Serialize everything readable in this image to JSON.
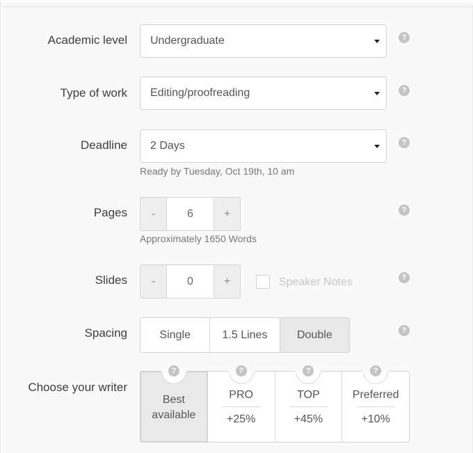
{
  "form": {
    "academic_level": {
      "label": "Academic level",
      "value": "Undergraduate"
    },
    "type_of_work": {
      "label": "Type of work",
      "value": "Editing/proofreading"
    },
    "deadline": {
      "label": "Deadline",
      "value": "2 Days",
      "hint": "Ready by Tuesday, Oct 19th, 10 am"
    },
    "pages": {
      "label": "Pages",
      "value": "6",
      "decrement": "-",
      "increment": "+",
      "hint": "Approximately 1650 Words"
    },
    "slides": {
      "label": "Slides",
      "value": "0",
      "decrement": "-",
      "increment": "+",
      "speaker_notes_label": "Speaker Notes",
      "speaker_notes_checked": false
    },
    "spacing": {
      "label": "Spacing",
      "options": [
        "Single",
        "1.5 Lines",
        "Double"
      ],
      "selected": "Double"
    },
    "writer": {
      "label": "Choose your writer",
      "options": [
        {
          "line1": "Best",
          "line2": "available",
          "selected": true
        },
        {
          "name": "PRO",
          "price": "+25%"
        },
        {
          "name": "TOP",
          "price": "+45%"
        },
        {
          "name": "Preferred",
          "price": "+10%"
        }
      ]
    },
    "help_glyph": "?"
  }
}
